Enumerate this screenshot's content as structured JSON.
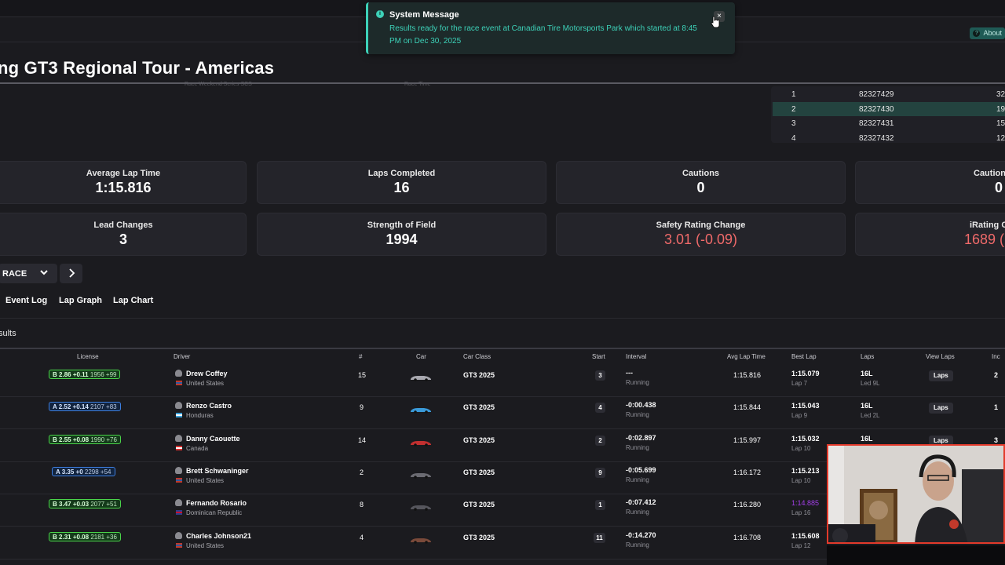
{
  "header": {
    "about_label": "About"
  },
  "title": "ng GT3 Regional Tour - Americas",
  "ghost": {
    "left": "Race Weekend Series SCS",
    "right": "Race Time"
  },
  "subsessions": [
    {
      "pos": "1",
      "id": "82327429",
      "val": "32"
    },
    {
      "pos": "2",
      "id": "82327430",
      "val": "19"
    },
    {
      "pos": "3",
      "id": "82327431",
      "val": "15"
    },
    {
      "pos": "4",
      "id": "82327432",
      "val": "12"
    }
  ],
  "stats": {
    "avg_lap": {
      "label": "Average Lap Time",
      "value": "1:15.816"
    },
    "laps_completed": {
      "label": "Laps Completed",
      "value": "16"
    },
    "cautions": {
      "label": "Cautions",
      "value": "0"
    },
    "caution_laps": {
      "label": "Caution",
      "value": "0"
    },
    "lead_changes": {
      "label": "Lead Changes",
      "value": "3"
    },
    "sof": {
      "label": "Strength of Field",
      "value": "1994"
    },
    "sr_change": {
      "label": "Safety Rating Change",
      "value": "3.01 (-0.09)"
    },
    "ir_change": {
      "label": "iRating C",
      "value": "1689 ("
    }
  },
  "session": {
    "label": "RACE"
  },
  "tabs": {
    "event_log": "Event Log",
    "lap_graph": "Lap Graph",
    "lap_chart": "Lap Chart"
  },
  "section_title": "sults",
  "columns": {
    "license": "License",
    "driver": "Driver",
    "num": "#",
    "car": "Car",
    "car_class": "Car Class",
    "start": "Start",
    "interval": "Interval",
    "avg_lap": "Avg Lap Time",
    "best_lap": "Best Lap",
    "laps": "Laps",
    "view_laps": "View Laps",
    "inc": "Inc"
  },
  "rows": [
    {
      "lic_class": "B",
      "lic_sr": "2.86",
      "lic_delta": "+0.11",
      "lic_ir": "1956",
      "lic_ir_delta": "+99",
      "name": "Drew Coffey",
      "country": "United States",
      "num": "15",
      "car_color": "#a9a9b0",
      "class": "GT3 2025",
      "start": "3",
      "interval": "---",
      "status": "Running",
      "avg": "1:15.816",
      "best": "1:15.079",
      "best_lap": "Lap 7",
      "laps": "16L",
      "led": "Led 9L",
      "view": "Laps",
      "inc": "2"
    },
    {
      "lic_class": "A",
      "lic_sr": "2.52",
      "lic_delta": "+0.14",
      "lic_ir": "2107",
      "lic_ir_delta": "+83",
      "name": "Renzo Castro",
      "country": "Honduras",
      "num": "9",
      "car_color": "#3a9ad9",
      "class": "GT3 2025",
      "start": "4",
      "interval": "-0:00.438",
      "status": "Running",
      "avg": "1:15.844",
      "best": "1:15.043",
      "best_lap": "Lap 9",
      "laps": "16L",
      "led": "Led 2L",
      "view": "Laps",
      "inc": "1"
    },
    {
      "lic_class": "B",
      "lic_sr": "2.55",
      "lic_delta": "+0.08",
      "lic_ir": "1990",
      "lic_ir_delta": "+76",
      "name": "Danny Caouette",
      "country": "Canada",
      "num": "14",
      "car_color": "#c23030",
      "class": "GT3 2025",
      "start": "2",
      "interval": "-0:02.897",
      "status": "Running",
      "avg": "1:15.997",
      "best": "1:15.032",
      "best_lap": "Lap 10",
      "laps": "16L",
      "led": "",
      "view": "Laps",
      "inc": "3"
    },
    {
      "lic_class": "A",
      "lic_sr": "3.35",
      "lic_delta": "+0",
      "lic_ir": "2298",
      "lic_ir_delta": "+54",
      "name": "Brett Schwaninger",
      "country": "United States",
      "num": "2",
      "car_color": "#6b6b72",
      "class": "GT3 2025",
      "start": "9",
      "interval": "-0:05.699",
      "status": "Running",
      "avg": "1:16.172",
      "best": "1:15.213",
      "best_lap": "Lap 10",
      "laps": "",
      "led": "",
      "view": "",
      "inc": ""
    },
    {
      "lic_class": "B",
      "lic_sr": "3.47",
      "lic_delta": "+0.03",
      "lic_ir": "2077",
      "lic_ir_delta": "+51",
      "name": "Fernando Rosario",
      "country": "Dominican Republic",
      "num": "8",
      "car_color": "#55555c",
      "class": "GT3 2025",
      "start": "1",
      "interval": "-0:07.412",
      "status": "Running",
      "avg": "1:16.280",
      "best": "1:14.885",
      "best_lap": "Lap 16",
      "laps": "",
      "led": "",
      "view": "",
      "inc": ""
    },
    {
      "lic_class": "B",
      "lic_sr": "2.31",
      "lic_delta": "+0.08",
      "lic_ir": "2181",
      "lic_ir_delta": "+36",
      "name": "Charles Johnson21",
      "country": "United States",
      "num": "4",
      "car_color": "#7a4a3a",
      "class": "GT3 2025",
      "start": "11",
      "interval": "-0:14.270",
      "status": "Running",
      "avg": "1:16.708",
      "best": "1:15.608",
      "best_lap": "Lap 12",
      "laps": "",
      "led": "",
      "view": "",
      "inc": ""
    }
  ],
  "toast": {
    "title": "System Message",
    "body": "Results ready for the race event at Canadian Tire Motorsports Park which started at 8:45 PM on Dec 30, 2025",
    "close": "×"
  },
  "colors": {
    "accent": "#3dd1b8",
    "negative": "#f06a6a",
    "purple_best": "#a23ee8",
    "webcam_border": "#e33a2b"
  },
  "icons": [
    "info-icon",
    "close-icon",
    "chevron-down-icon",
    "chevron-right-icon",
    "helmet-icon",
    "flag-icon",
    "car-icon"
  ]
}
